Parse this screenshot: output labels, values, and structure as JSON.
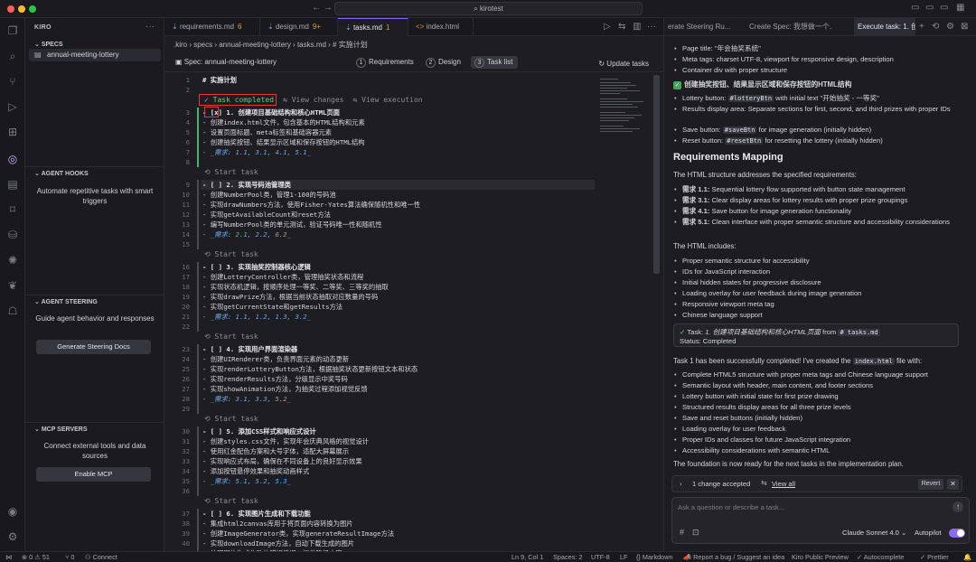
{
  "window": {
    "title": "kirotest"
  },
  "side": {
    "title": "KIRO",
    "specs_header": "SPECS",
    "spec_item": "annual-meeting-lottery",
    "hooks_header": "AGENT HOOKS",
    "hooks_desc": "Automate repetitive tasks with smart triggers",
    "steering_header": "AGENT STEERING",
    "steering_desc": "Guide agent behavior and responses",
    "steering_button": "Generate Steering Docs",
    "mcp_header": "MCP SERVERS",
    "mcp_desc": "Connect external tools and data sources",
    "mcp_button": "Enable MCP"
  },
  "editor": {
    "tabs": [
      {
        "label": "requirements.md",
        "badge": "6"
      },
      {
        "label": "design.md",
        "badge": "9+"
      },
      {
        "label": "tasks.md",
        "badge": "1"
      },
      {
        "label": "index.html",
        "badge": ""
      }
    ],
    "breadcrumb": ".kiro  ›  specs  ›  annual-meeting-lottery  ›  tasks.md  ›  # 实施计划",
    "spec_title": "Spec: annual-meeting-lottery",
    "steps": [
      {
        "num": "1",
        "label": "Requirements"
      },
      {
        "num": "2",
        "label": "Design"
      },
      {
        "num": "3",
        "label": "Task list"
      }
    ],
    "update_tasks": "Update tasks",
    "lens_completed": "✓ Task completed",
    "lens_changes": "View changes",
    "lens_execution": "View execution",
    "lens_start": "Start task",
    "lines": [
      {
        "n": "1",
        "t": "# 实施计划"
      },
      {
        "n": "2",
        "t": ""
      },
      {
        "n": "3",
        "t": "- [x] 1. 创建项目基础结构和核心HTML页面"
      },
      {
        "n": "4",
        "t": "  - 创建index.html文件，包含基本的HTML结构和元素"
      },
      {
        "n": "5",
        "t": "  - 设置页面标题、meta标签和基础容器元素"
      },
      {
        "n": "6",
        "t": "  - 创建抽奖按钮、结果显示区域和保存按钮的HTML结构"
      },
      {
        "n": "7",
        "t": "  - _需求: 1.1, 3.1, 4.1, 5.1_"
      },
      {
        "n": "8",
        "t": ""
      },
      {
        "n": "9",
        "t": "- [ ] 2. 实现号码池管理类"
      },
      {
        "n": "10",
        "t": "  - 创建NumberPool类，管理1-100的号码池"
      },
      {
        "n": "11",
        "t": "  - 实现drawNumbers方法，使用Fisher-Yates算法确保随机性和唯一性"
      },
      {
        "n": "12",
        "t": "  - 实现getAvailableCount和reset方法"
      },
      {
        "n": "13",
        "t": "  - 编写NumberPool类的单元测试，验证号码唯一性和随机性"
      },
      {
        "n": "14",
        "t": "  - _需求: 2.1, 2.2, 6.2_"
      },
      {
        "n": "15",
        "t": ""
      },
      {
        "n": "16",
        "t": "- [ ] 3. 实现抽奖控制器核心逻辑"
      },
      {
        "n": "17",
        "t": "  - 创建LotteryController类，管理抽奖状态和流程"
      },
      {
        "n": "18",
        "t": "  - 实现状态机逻辑，按顺序处理一等奖、二等奖、三等奖的抽取"
      },
      {
        "n": "19",
        "t": "  - 实现drawPrize方法，根据当前状态抽取对应数量的号码"
      },
      {
        "n": "20",
        "t": "  - 实现getCurrentState和getResults方法"
      },
      {
        "n": "21",
        "t": "  - _需求: 1.1, 1.2, 1.3, 3.2_"
      },
      {
        "n": "22",
        "t": ""
      },
      {
        "n": "23",
        "t": "- [ ] 4. 实现用户界面渲染器"
      },
      {
        "n": "24",
        "t": "  - 创建UIRenderer类，负责界面元素的动态更新"
      },
      {
        "n": "25",
        "t": "  - 实现renderLotteryButton方法，根据抽奖状态更新按钮文本和状态"
      },
      {
        "n": "26",
        "t": "  - 实现renderResults方法，分级显示中奖号码"
      },
      {
        "n": "27",
        "t": "  - 实现showAnimation方法，为抽奖过程添加视觉反馈"
      },
      {
        "n": "28",
        "t": "  - _需求: 3.1, 3.3, 5.2_"
      },
      {
        "n": "29",
        "t": ""
      },
      {
        "n": "30",
        "t": "- [ ] 5. 添加CSS样式和响应式设计"
      },
      {
        "n": "31",
        "t": "  - 创建styles.css文件，实现年会庆典风格的视觉设计"
      },
      {
        "n": "32",
        "t": "  - 使用红金配色方案和大号字体，适配大屏幕展示"
      },
      {
        "n": "33",
        "t": "  - 实现响应式布局，确保在不同设备上的良好显示效果"
      },
      {
        "n": "34",
        "t": "  - 添加按钮悬停效果和抽奖动画样式"
      },
      {
        "n": "35",
        "t": "  - _需求: 5.1, 5.2, 5.3_"
      },
      {
        "n": "36",
        "t": ""
      },
      {
        "n": "37",
        "t": "- [ ] 6. 实现图片生成和下载功能"
      },
      {
        "n": "38",
        "t": "  - 集成html2canvas库用于将页面内容转换为图片"
      },
      {
        "n": "39",
        "t": "  - 创建ImageGenerator类，实现generateResultImage方法"
      },
      {
        "n": "40",
        "t": "  - 实现downloadImage方法，自动下载生成的图片"
      },
      {
        "n": "41",
        "t": "  - 处理图片生成失败的错误情况，提供降级方案"
      }
    ]
  },
  "chat": {
    "tabs": [
      "erate Steering Ru...",
      "Create Spec: 我想做一个...",
      "Execute task: 1. 创"
    ],
    "top_bullets": [
      "Page title: \"年会抽奖系统\"",
      "Meta tags: charset UTF-8, viewport for responsive design, description",
      "Container div with proper structure"
    ],
    "section_check": "创建抽奖按钮、结果显示区域和保存按钮的HTML结构",
    "button_bullets": [
      {
        "pre": "Lottery button: ",
        "code": "#lotteryBtn",
        "post": " with initial text \"开始抽奖 - 一等奖\""
      },
      {
        "pre": "Results display area: Separate sections for first, second, and third prizes with proper IDs",
        "code": "",
        "post": ""
      },
      {
        "pre": "Save button: ",
        "code": "#saveBtn",
        "post": " for image generation (initially hidden)"
      },
      {
        "pre": "Reset button: ",
        "code": "#resetBtn",
        "post": " for resetting the lottery (initially hidden)"
      }
    ],
    "req_heading": "Requirements Mapping",
    "req_intro": "The HTML structure addresses the specified requirements:",
    "req_bullets": [
      {
        "b": "需求 1.1:",
        "t": " Sequential lottery flow supported with button state management"
      },
      {
        "b": "需求 3.1:",
        "t": " Clear display areas for lottery results with proper prize groupings"
      },
      {
        "b": "需求 4.1:",
        "t": " Save button for image generation functionality"
      },
      {
        "b": "需求 5.1:",
        "t": " Clean interface with proper semantic structure and accessibility considerations"
      }
    ],
    "includes_intro": "The HTML includes:",
    "includes": [
      "Proper semantic structure for accessibility",
      "IDs for JavaScript interaction",
      "Initial hidden states for progressive disclosure",
      "Loading overlay for user feedback during image generation",
      "Responsive viewport meta tag",
      "Chinese language support"
    ],
    "task_card_pre": "Task: ",
    "task_card_name": "1. 创建项目基础结构和核心HTML页面",
    "task_card_from": " from ",
    "task_card_file": "# tasks.md",
    "task_card_status": "Status: Completed",
    "success_pre": "Task 1 has been successfully completed! I've created the ",
    "success_file": "index.html",
    "success_post": " file with:",
    "success_bullets": [
      "Complete HTML5 structure with proper meta tags and Chinese language support",
      "Semantic layout with header, main content, and footer sections",
      "Lottery button with initial state for first prize drawing",
      "Structured results display areas for all three prize levels",
      "Save and reset buttons (initially hidden)",
      "Loading overlay for user feedback",
      "Proper IDs and classes for future JavaScript integration",
      "Accessibility considerations with semantic HTML"
    ],
    "foundation": "The foundation is now ready for the next tasks in the implementation plan.",
    "changes_label": "1 change accepted",
    "view_all": "View all",
    "revert": "Revert",
    "input_placeholder": "Ask a question or describe a task...",
    "model": "Claude Sonnet 4.0",
    "autopilot": "Autopilot"
  },
  "status": {
    "errors": "0",
    "warnings": "51",
    "ports": "0",
    "connect": "Connect",
    "position": "Ln 9, Col 1",
    "spaces": "Spaces: 2",
    "encoding": "UTF-8",
    "eol": "LF",
    "language": "Markdown",
    "report": "Report a bug / Suggest an idea",
    "preview": "Kiro Public Preview",
    "autocomplete": "Autocomplete",
    "prettier": "Prettier"
  },
  "colors": {
    "accent": "#8a6cf0",
    "success": "#3ea95a",
    "highlight_box": "#e03a3a"
  }
}
